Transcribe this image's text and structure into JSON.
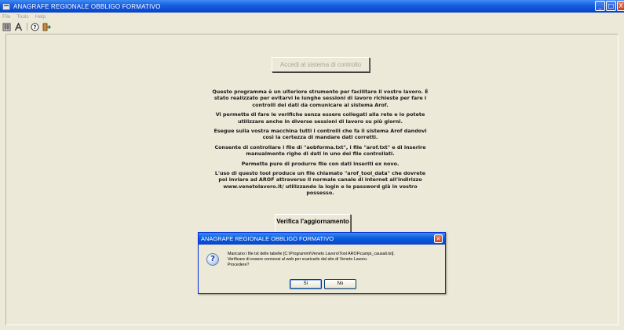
{
  "window": {
    "title": "ANAGRAFE REGIONALE OBBLIGO FORMATIVO",
    "controls": {
      "minimize": "_",
      "maximize": "□",
      "close": "X"
    }
  },
  "menubar": {
    "items": [
      "File",
      "Tools",
      "Help"
    ]
  },
  "toolbar": {
    "icons": [
      "grid-icon",
      "text-a-icon",
      "help-circle-icon",
      "exit-icon"
    ]
  },
  "main": {
    "accedi_button": "Accedi al sistema di controllo",
    "paragraphs": [
      "Questo programma è un ulteriore strumento per facilitare il vostro lavoro. È stato realizzato per evitarvi le lunghe sessioni di lavoro richieste per fare i controlli dei dati da comunicare al sistema Arof.",
      "Vi permette di fare le verifiche senza essere collegati alla rete e lo potete utilizzare anche in diverse sessioni di lavoro su più giorni.",
      "Esegue sulla vostra macchina tutti i controlli che fa il sistema Arof dandovi così la certezza di mandare dati corretti.",
      "Consente di controllare i file di \"aobforma.txt\", i file \"arof.txt\" e di inserire manualmente righe di dati in uno dei file controllati.",
      "Permette pure di produrre file con dati inseriti ex novo.",
      "L'uso di questo tool produce un file chiamato \"arof_tool_data\" che dovrete poi inviare ad AROF attraverso il normale canale di internet all'indirizzo www.venetolavoro.it/ utilizzando la login e le password già in vostro possesso."
    ],
    "verifica_button": "Verifica l'aggiornamento"
  },
  "dialog": {
    "title": "ANAGRAFE REGIONALE OBBLIGO FORMATIVO",
    "message_lines": [
      "Mancano i file txt delle tabelle [C:\\Programmi\\Veneto Lavoro\\Tool AROF\\campi_causali.txt].",
      "Verificare di essere connessi al web per scaricarle dal sito di Veneto Lavoro.",
      "Procedere?"
    ],
    "yes_label": "Sì",
    "no_label": "No",
    "icon": "question-icon"
  },
  "colors": {
    "titlebar": "#0a4bd3",
    "window_bg": "#ece9d8",
    "dialog_border": "#0831d9"
  }
}
